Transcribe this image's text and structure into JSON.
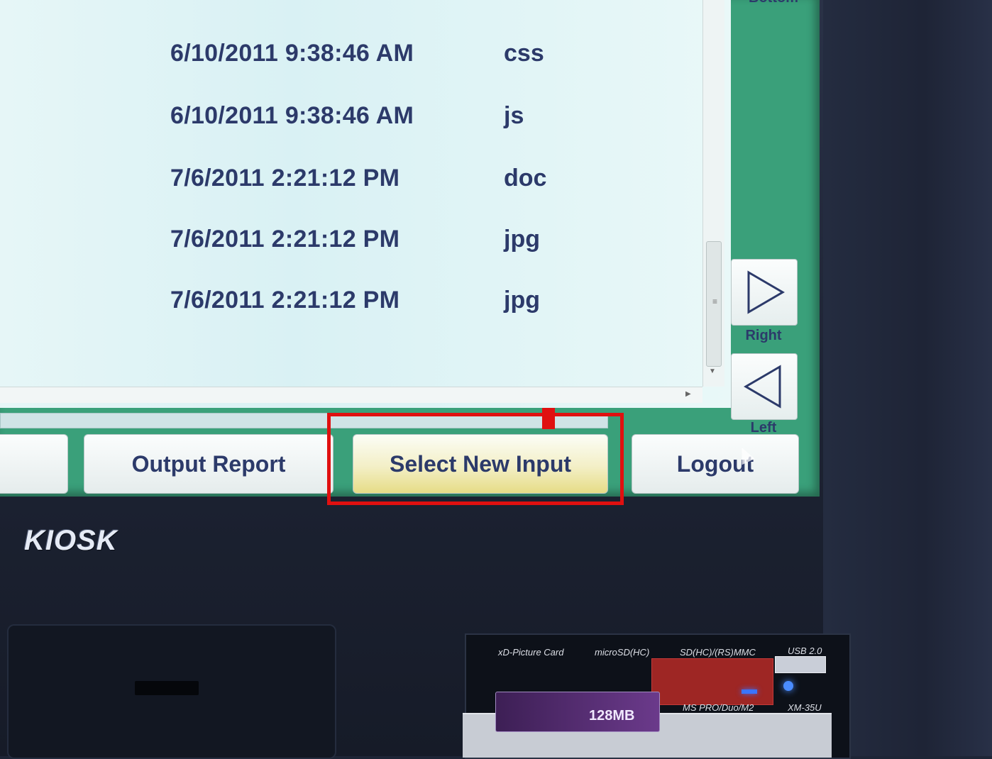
{
  "screen": {
    "top_label_partial": "Bottom",
    "rows": [
      {
        "date": "6/10/2011 9:38:46 AM",
        "ext": "css"
      },
      {
        "date": "6/10/2011 9:38:46 AM",
        "ext": "js"
      },
      {
        "date": "7/6/2011 2:21:12 PM",
        "ext": "doc"
      },
      {
        "date": "7/6/2011 2:21:12 PM",
        "ext": "jpg"
      },
      {
        "date": "7/6/2011 2:21:12 PM",
        "ext": "jpg"
      }
    ],
    "nav": {
      "right_label": "Right",
      "left_label": "Left"
    },
    "buttons": {
      "output_report": "Output Report",
      "select_new_input": "Select New Input",
      "logout": "Logout"
    },
    "highlight_color": "#e01010"
  },
  "hardware": {
    "logo": "KIOSK",
    "reader_labels": {
      "xd": "xD-Picture Card",
      "microsd": "microSD(HC)",
      "sd": "SD(HC)/(RS)MMC",
      "usb": "USB 2.0",
      "ms": "MS PRO/Duo/M2",
      "model": "XM-35U"
    },
    "card_label": "128MB"
  }
}
